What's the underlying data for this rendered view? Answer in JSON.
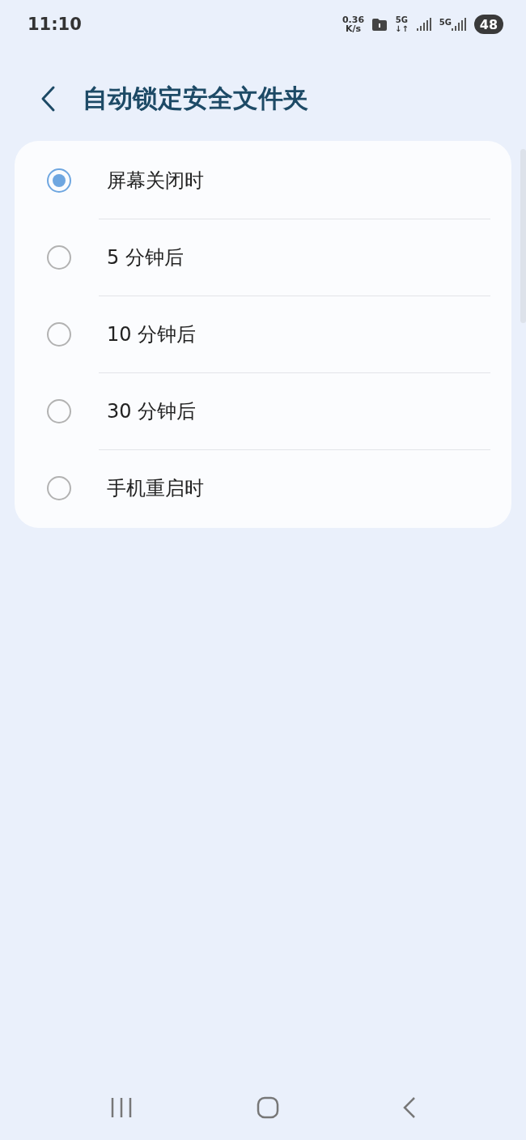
{
  "status_bar": {
    "time": "11:10",
    "net_speed": "0.36",
    "net_unit": "K/s",
    "net_type": "5G",
    "net_arrows": "↓↑",
    "sim_type": "5G",
    "battery": "48"
  },
  "header": {
    "title": "自动锁定安全文件夹"
  },
  "options": [
    {
      "label": "屏幕关闭时",
      "selected": true
    },
    {
      "label": "5 分钟后",
      "selected": false
    },
    {
      "label": "10 分钟后",
      "selected": false
    },
    {
      "label": "30 分钟后",
      "selected": false
    },
    {
      "label": "手机重启时",
      "selected": false
    }
  ]
}
